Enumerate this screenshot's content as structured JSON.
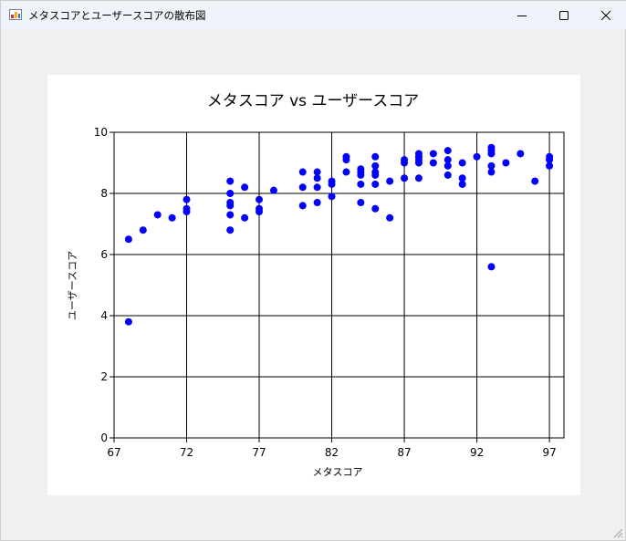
{
  "window": {
    "title": "メタスコアとユーザースコアの散布図",
    "icon": "chart-app-icon",
    "controls": {
      "minimize": "minimize-icon",
      "maximize": "maximize-icon",
      "close": "close-icon"
    }
  },
  "chart_data": {
    "type": "scatter",
    "title": "メタスコア vs ユーザースコア",
    "xlabel": "メタスコア",
    "ylabel": "ユーザースコア",
    "xlim": [
      67,
      98
    ],
    "ylim": [
      0,
      10
    ],
    "xticks": [
      67,
      72,
      77,
      82,
      87,
      92,
      97
    ],
    "yticks": [
      0,
      2,
      4,
      6,
      8,
      10
    ],
    "grid": true,
    "marker_color": "#0000ff",
    "points": [
      [
        68,
        6.5
      ],
      [
        68,
        3.8
      ],
      [
        69,
        6.8
      ],
      [
        70,
        7.3
      ],
      [
        71,
        7.2
      ],
      [
        72,
        7.8
      ],
      [
        72,
        7.5
      ],
      [
        72,
        7.4
      ],
      [
        75,
        8.4
      ],
      [
        75,
        8.0
      ],
      [
        75,
        7.7
      ],
      [
        75,
        7.6
      ],
      [
        75,
        7.3
      ],
      [
        75,
        6.8
      ],
      [
        76,
        8.2
      ],
      [
        76,
        7.2
      ],
      [
        77,
        7.8
      ],
      [
        77,
        7.5
      ],
      [
        77,
        7.4
      ],
      [
        78,
        8.1
      ],
      [
        80,
        8.7
      ],
      [
        80,
        8.2
      ],
      [
        80,
        7.6
      ],
      [
        81,
        8.7
      ],
      [
        81,
        8.5
      ],
      [
        81,
        8.2
      ],
      [
        81,
        7.7
      ],
      [
        82,
        8.4
      ],
      [
        82,
        8.3
      ],
      [
        82,
        7.9
      ],
      [
        83,
        9.2
      ],
      [
        83,
        9.1
      ],
      [
        83,
        8.7
      ],
      [
        84,
        8.8
      ],
      [
        84,
        8.7
      ],
      [
        84,
        8.6
      ],
      [
        84,
        8.3
      ],
      [
        84,
        7.7
      ],
      [
        85,
        9.2
      ],
      [
        85,
        8.9
      ],
      [
        85,
        8.7
      ],
      [
        85,
        8.6
      ],
      [
        85,
        8.3
      ],
      [
        85,
        7.5
      ],
      [
        86,
        8.4
      ],
      [
        86,
        7.2
      ],
      [
        87,
        9.1
      ],
      [
        87,
        9.0
      ],
      [
        87,
        8.5
      ],
      [
        88,
        9.3
      ],
      [
        88,
        9.2
      ],
      [
        88,
        9.1
      ],
      [
        88,
        9.0
      ],
      [
        88,
        8.5
      ],
      [
        89,
        9.3
      ],
      [
        89,
        9.0
      ],
      [
        90,
        9.4
      ],
      [
        90,
        9.1
      ],
      [
        90,
        8.9
      ],
      [
        90,
        8.6
      ],
      [
        91,
        9.0
      ],
      [
        91,
        8.5
      ],
      [
        91,
        8.3
      ],
      [
        92,
        9.2
      ],
      [
        93,
        9.5
      ],
      [
        93,
        9.4
      ],
      [
        93,
        9.3
      ],
      [
        93,
        8.9
      ],
      [
        93,
        8.7
      ],
      [
        93,
        5.6
      ],
      [
        94,
        9.0
      ],
      [
        95,
        9.3
      ],
      [
        96,
        8.4
      ],
      [
        97,
        9.2
      ],
      [
        97,
        9.1
      ],
      [
        97,
        8.9
      ]
    ]
  }
}
